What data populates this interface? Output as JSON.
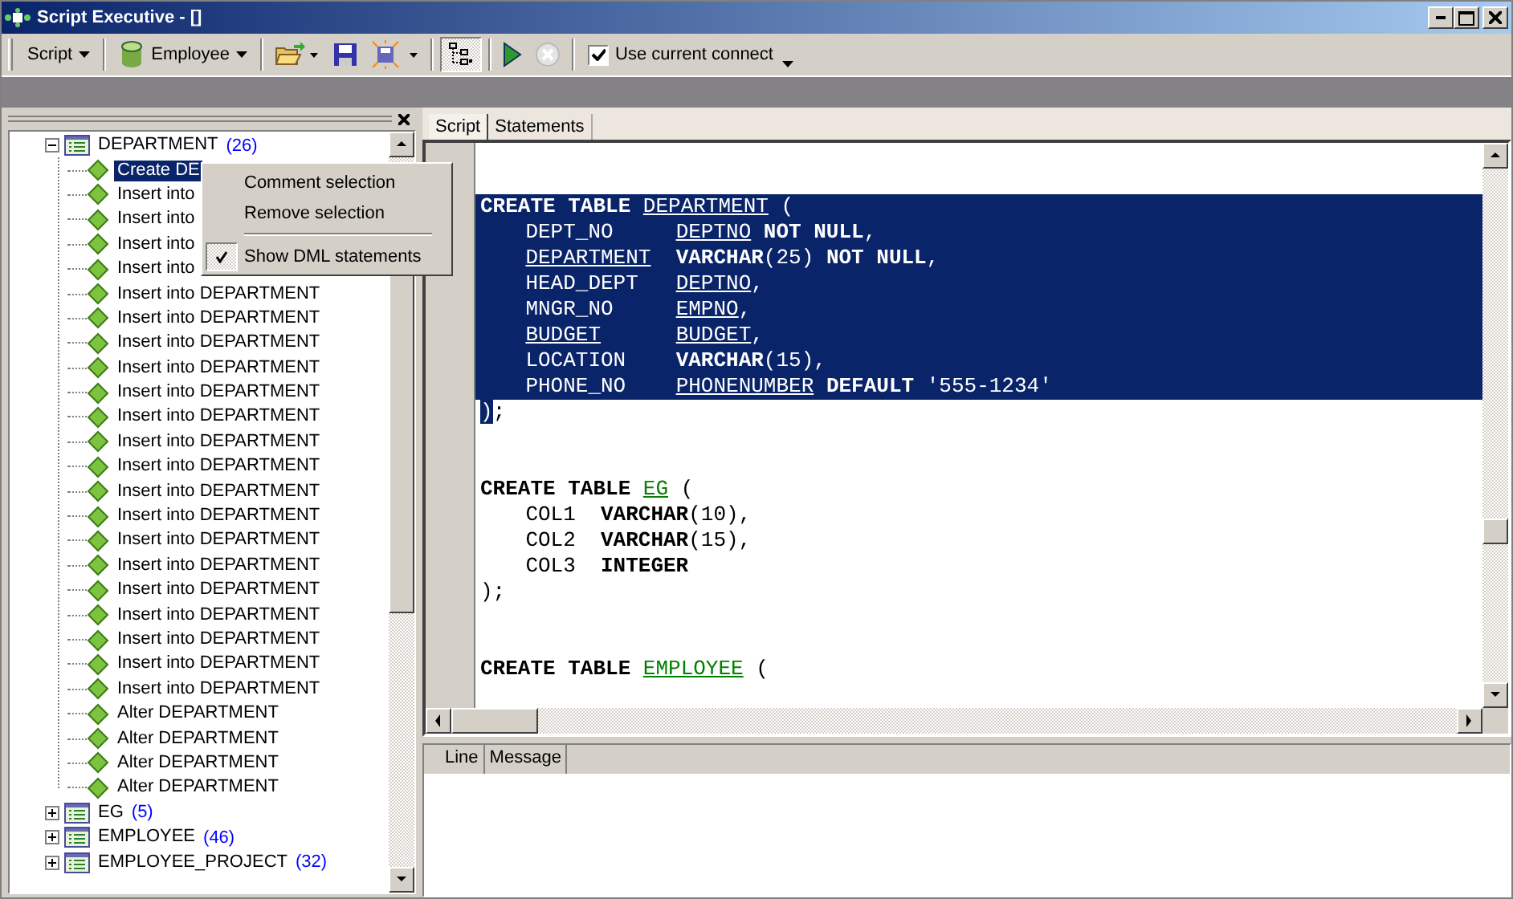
{
  "window": {
    "title": "Script Executive - []"
  },
  "toolbar": {
    "script_menu": {
      "label": "Script"
    },
    "connection_menu": {
      "label": "Employee"
    },
    "tree_toggle": {
      "on": true
    },
    "run": {
      "disabled": false
    },
    "stop": {
      "disabled": true
    },
    "use_current_connection": {
      "label": "Use current connect",
      "checked": true
    }
  },
  "tree": {
    "items": [
      {
        "kind": "table",
        "label": "DEPARTMENT",
        "count": "(26)",
        "expanded": true,
        "selected": false,
        "children": [
          {
            "kind": "statement",
            "label": "Create DE",
            "selected": true
          },
          {
            "kind": "statement",
            "label": "Insert into",
            "selected": false
          },
          {
            "kind": "statement",
            "label": "Insert into",
            "selected": false
          },
          {
            "kind": "statement",
            "label": "Insert into",
            "selected": false
          },
          {
            "kind": "statement",
            "label": "Insert into",
            "selected": false
          },
          {
            "kind": "statement",
            "label": "Insert into DEPARTMENT",
            "selected": false
          },
          {
            "kind": "statement",
            "label": "Insert into DEPARTMENT",
            "selected": false
          },
          {
            "kind": "statement",
            "label": "Insert into DEPARTMENT",
            "selected": false
          },
          {
            "kind": "statement",
            "label": "Insert into DEPARTMENT",
            "selected": false
          },
          {
            "kind": "statement",
            "label": "Insert into DEPARTMENT",
            "selected": false
          },
          {
            "kind": "statement",
            "label": "Insert into DEPARTMENT",
            "selected": false
          },
          {
            "kind": "statement",
            "label": "Insert into DEPARTMENT",
            "selected": false
          },
          {
            "kind": "statement",
            "label": "Insert into DEPARTMENT",
            "selected": false
          },
          {
            "kind": "statement",
            "label": "Insert into DEPARTMENT",
            "selected": false
          },
          {
            "kind": "statement",
            "label": "Insert into DEPARTMENT",
            "selected": false
          },
          {
            "kind": "statement",
            "label": "Insert into DEPARTMENT",
            "selected": false
          },
          {
            "kind": "statement",
            "label": "Insert into DEPARTMENT",
            "selected": false
          },
          {
            "kind": "statement",
            "label": "Insert into DEPARTMENT",
            "selected": false
          },
          {
            "kind": "statement",
            "label": "Insert into DEPARTMENT",
            "selected": false
          },
          {
            "kind": "statement",
            "label": "Insert into DEPARTMENT",
            "selected": false
          },
          {
            "kind": "statement",
            "label": "Insert into DEPARTMENT",
            "selected": false
          },
          {
            "kind": "statement",
            "label": "Insert into DEPARTMENT",
            "selected": false
          },
          {
            "kind": "statement",
            "label": "Alter DEPARTMENT",
            "selected": false
          },
          {
            "kind": "statement",
            "label": "Alter DEPARTMENT",
            "selected": false
          },
          {
            "kind": "statement",
            "label": "Alter DEPARTMENT",
            "selected": false
          },
          {
            "kind": "statement",
            "label": "Alter DEPARTMENT",
            "selected": false
          }
        ]
      },
      {
        "kind": "table",
        "label": "EG",
        "count": "(5)",
        "expanded": false,
        "selected": false
      },
      {
        "kind": "table",
        "label": "EMPLOYEE",
        "count": "(46)",
        "expanded": false,
        "selected": false
      },
      {
        "kind": "table",
        "label": "EMPLOYEE_PROJECT",
        "count": "(32)",
        "expanded": false,
        "selected": false
      }
    ]
  },
  "context_menu": {
    "items": [
      {
        "kind": "item",
        "label": "Comment selection",
        "checked": false
      },
      {
        "kind": "item",
        "label": "Remove selection",
        "checked": false
      },
      {
        "kind": "separator"
      },
      {
        "kind": "item",
        "label": "Show DML statements",
        "checked": true
      }
    ]
  },
  "tabs": [
    {
      "label": "Script",
      "selected": true
    },
    {
      "label": "Statements",
      "selected": false
    }
  ],
  "editor": {
    "lines": [
      {
        "selected": false
      },
      {
        "selected": false
      },
      {
        "selected": true,
        "indented": false,
        "tokens": [
          {
            "kind": "kw",
            "text": "CREATE TABLE "
          },
          {
            "kind": "ref",
            "text": "DEPARTMENT"
          },
          {
            "kind": "id",
            "text": " ("
          }
        ]
      },
      {
        "selected": true,
        "indented": true,
        "columns": [
          [
            {
              "kind": "id",
              "text": "DEPT_NO"
            }
          ],
          [
            {
              "kind": "ref",
              "text": "DEPTNO"
            },
            {
              "kind": "kw",
              "text": " NOT NULL"
            },
            {
              "kind": "id",
              "text": ","
            }
          ]
        ]
      },
      {
        "selected": true,
        "indented": true,
        "columns": [
          [
            {
              "kind": "ref",
              "text": "DEPARTMENT"
            }
          ],
          [
            {
              "kind": "kw",
              "text": "VARCHAR"
            },
            {
              "kind": "id",
              "text": "(25) "
            },
            {
              "kind": "kw",
              "text": "NOT NULL"
            },
            {
              "kind": "id",
              "text": ","
            }
          ]
        ]
      },
      {
        "selected": true,
        "indented": true,
        "columns": [
          [
            {
              "kind": "id",
              "text": "HEAD_DEPT"
            }
          ],
          [
            {
              "kind": "ref",
              "text": "DEPTNO"
            },
            {
              "kind": "id",
              "text": ","
            }
          ]
        ]
      },
      {
        "selected": true,
        "indented": true,
        "columns": [
          [
            {
              "kind": "id",
              "text": "MNGR_NO"
            }
          ],
          [
            {
              "kind": "ref",
              "text": "EMPNO"
            },
            {
              "kind": "id",
              "text": ","
            }
          ]
        ]
      },
      {
        "selected": true,
        "indented": true,
        "columns": [
          [
            {
              "kind": "ref",
              "text": "BUDGET"
            }
          ],
          [
            {
              "kind": "ref",
              "text": "BUDGET"
            },
            {
              "kind": "id",
              "text": ","
            }
          ]
        ]
      },
      {
        "selected": true,
        "indented": true,
        "columns": [
          [
            {
              "kind": "id",
              "text": "LOCATION"
            }
          ],
          [
            {
              "kind": "kw",
              "text": "VARCHAR"
            },
            {
              "kind": "id",
              "text": "(15),"
            }
          ]
        ]
      },
      {
        "selected": true,
        "indented": true,
        "columns": [
          [
            {
              "kind": "id",
              "text": "PHONE_NO"
            }
          ],
          [
            {
              "kind": "ref",
              "text": "PHONENUMBER"
            },
            {
              "kind": "kw",
              "text": " DEFAULT "
            },
            {
              "kind": "id",
              "text": "'555-1234'"
            }
          ]
        ]
      },
      {
        "selected": false,
        "indented": false,
        "tokens": [
          {
            "kind": "id",
            "text": ")",
            "selected": true
          },
          {
            "kind": "id",
            "text": ";",
            "selected": false
          }
        ]
      },
      {
        "selected": false
      },
      {
        "selected": false
      },
      {
        "selected": false,
        "indented": false,
        "tokens": [
          {
            "kind": "kw",
            "text": "CREATE TABLE "
          },
          {
            "kind": "ref-new",
            "text": "EG"
          },
          {
            "kind": "id",
            "text": " ("
          }
        ]
      },
      {
        "selected": false,
        "indented": true,
        "columns": [
          [
            {
              "kind": "id",
              "text": "COL1"
            }
          ],
          [
            {
              "kind": "kw",
              "text": "VARCHAR"
            },
            {
              "kind": "id",
              "text": "(10),"
            }
          ]
        ]
      },
      {
        "selected": false,
        "indented": true,
        "columns": [
          [
            {
              "kind": "id",
              "text": "COL2"
            }
          ],
          [
            {
              "kind": "kw",
              "text": "VARCHAR"
            },
            {
              "kind": "id",
              "text": "(15),"
            }
          ]
        ]
      },
      {
        "selected": false,
        "indented": true,
        "columns": [
          [
            {
              "kind": "id",
              "text": "COL3"
            }
          ],
          [
            {
              "kind": "kw",
              "text": "INTEGER"
            }
          ]
        ]
      },
      {
        "selected": false,
        "indented": false,
        "tokens": [
          {
            "kind": "id",
            "text": ");"
          }
        ]
      },
      {
        "selected": false
      },
      {
        "selected": false
      },
      {
        "selected": false,
        "indented": false,
        "tokens": [
          {
            "kind": "kw",
            "text": "CREATE TABLE "
          },
          {
            "kind": "ref-new",
            "text": "EMPLOYEE"
          },
          {
            "kind": "id",
            "text": " ("
          }
        ]
      }
    ]
  },
  "messages": {
    "columns": [
      "Line",
      "Message"
    ]
  }
}
